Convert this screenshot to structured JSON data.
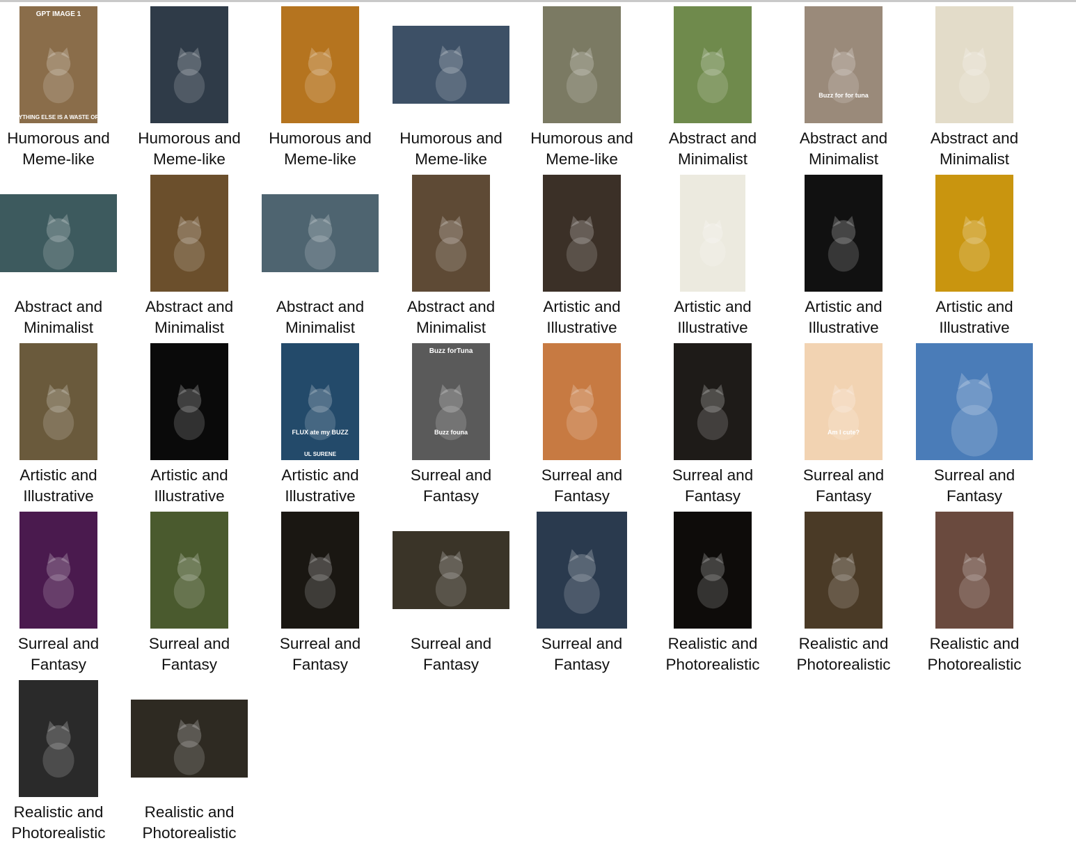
{
  "items": [
    {
      "line1": "Humorous and",
      "line2": "Meme-like",
      "shape": "portrait",
      "bg": "#8a6d4a",
      "text_top": "GPT IMAGE 1",
      "text_bottom": "EVERYTHING ELSE IS A WASTE OF TIME"
    },
    {
      "line1": "Humorous and",
      "line2": "Meme-like",
      "shape": "portrait",
      "bg": "#2f3b48"
    },
    {
      "line1": "Humorous and",
      "line2": "Meme-like",
      "shape": "portrait",
      "bg": "#b5741f"
    },
    {
      "line1": "Humorous and",
      "line2": "Meme-like",
      "shape": "landscape",
      "bg": "#3d5066"
    },
    {
      "line1": "Humorous and",
      "line2": "Meme-like",
      "shape": "portrait",
      "bg": "#7b7a63"
    },
    {
      "line1": "Abstract and",
      "line2": "Minimalist",
      "shape": "portrait",
      "bg": "#6f8a4c"
    },
    {
      "line1": "Abstract and",
      "line2": "Minimalist",
      "shape": "portrait",
      "bg": "#9a8a7a",
      "text_sign": "Buzz for for tuna"
    },
    {
      "line1": "Abstract and",
      "line2": "Minimalist",
      "shape": "portrait",
      "bg": "#e3dcc9"
    },
    {
      "line1": "Abstract and",
      "line2": "Minimalist",
      "shape": "landscape",
      "bg": "#3d5a5e"
    },
    {
      "line1": "Abstract and",
      "line2": "Minimalist",
      "shape": "portrait",
      "bg": "#6b4f2c"
    },
    {
      "line1": "Abstract and",
      "line2": "Minimalist",
      "shape": "landscape",
      "bg": "#4e6470"
    },
    {
      "line1": "Abstract and",
      "line2": "Minimalist",
      "shape": "portrait",
      "bg": "#5e4a35"
    },
    {
      "line1": "Artistic and",
      "line2": "Illustrative",
      "shape": "portrait",
      "bg": "#3b3027"
    },
    {
      "line1": "Artistic and",
      "line2": "Illustrative",
      "shape": "narrow",
      "bg": "#eceadf"
    },
    {
      "line1": "Artistic and",
      "line2": "Illustrative",
      "shape": "portrait",
      "bg": "#111111"
    },
    {
      "line1": "Artistic and",
      "line2": "Illustrative",
      "shape": "portrait",
      "bg": "#c9950f"
    },
    {
      "line1": "Artistic and",
      "line2": "Illustrative",
      "shape": "portrait",
      "bg": "#6a5a3c"
    },
    {
      "line1": "Artistic and",
      "line2": "Illustrative",
      "shape": "portrait",
      "bg": "#0a0a0a"
    },
    {
      "line1": "Artistic and",
      "line2": "Illustrative",
      "shape": "portrait",
      "bg": "#234a6a",
      "text_sign": "FLUX ate my BUZZ",
      "text_bottom": "UL SURENE"
    },
    {
      "line1": "Surreal and",
      "line2": "Fantasy",
      "shape": "portrait",
      "bg": "#5a5a5a",
      "text_top": "Buzz forTuna",
      "text_sign": "Buzz founa"
    },
    {
      "line1": "Surreal and",
      "line2": "Fantasy",
      "shape": "portrait",
      "bg": "#c77a42"
    },
    {
      "line1": "Surreal and",
      "line2": "Fantasy",
      "shape": "portrait",
      "bg": "#1e1b18"
    },
    {
      "line1": "Surreal and",
      "line2": "Fantasy",
      "shape": "portrait",
      "bg": "#f2d3b2",
      "text_sign": "Am I cute?"
    },
    {
      "line1": "Surreal and",
      "line2": "Fantasy",
      "shape": "landscape_tall",
      "bg": "#4a7cb8"
    },
    {
      "line1": "Surreal and",
      "line2": "Fantasy",
      "shape": "portrait",
      "bg": "#4a1a4e"
    },
    {
      "line1": "Surreal and",
      "line2": "Fantasy",
      "shape": "portrait",
      "bg": "#4a5a2e"
    },
    {
      "line1": "Surreal and",
      "line2": "Fantasy",
      "shape": "portrait",
      "bg": "#1a1712"
    },
    {
      "line1": "Surreal and",
      "line2": "Fantasy",
      "shape": "landscape",
      "bg": "#3a3428"
    },
    {
      "line1": "Surreal and",
      "line2": "Fantasy",
      "shape": "wideportrait",
      "bg": "#2a3a4e"
    },
    {
      "line1": "Realistic and",
      "line2": "Photorealistic",
      "shape": "portrait",
      "bg": "#0e0c0a"
    },
    {
      "line1": "Realistic and",
      "line2": "Photorealistic",
      "shape": "portrait",
      "bg": "#4a3a26"
    },
    {
      "line1": "Realistic and",
      "line2": "Photorealistic",
      "shape": "portrait",
      "bg": "#6a4a3e"
    },
    {
      "line1": "Realistic and",
      "line2": "Photorealistic",
      "shape": "portrait_wide",
      "bg": "#2a2a2a"
    },
    {
      "line1": "Realistic and",
      "line2": "Photorealistic",
      "shape": "landscape",
      "bg": "#2e2a22"
    }
  ]
}
